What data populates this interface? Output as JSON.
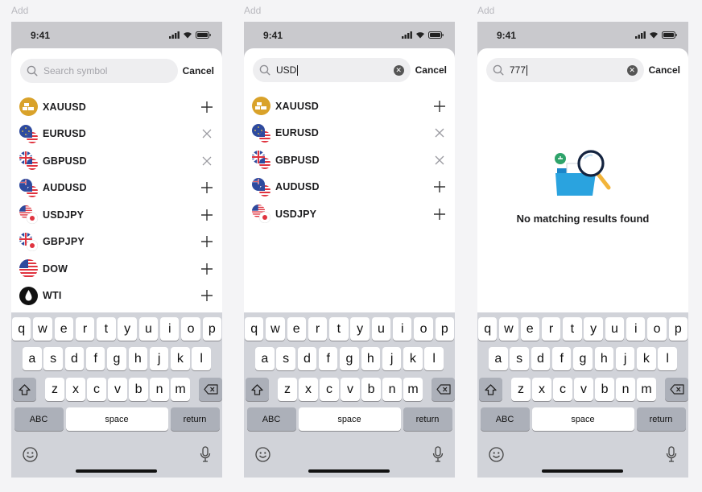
{
  "frames": [
    {
      "add_label": "Add",
      "time": "9:41",
      "search": {
        "value": "",
        "placeholder": "Search symbol",
        "cancel": "Cancel"
      },
      "rows": [
        {
          "symbol": "XAUUSD",
          "icon": "gold-icon",
          "action": "add"
        },
        {
          "symbol": "EURUSD",
          "icon": "eu-us-flag-icon",
          "action": "remove"
        },
        {
          "symbol": "GBPUSD",
          "icon": "uk-us-flag-icon",
          "action": "remove"
        },
        {
          "symbol": "AUDUSD",
          "icon": "au-us-flag-icon",
          "action": "add"
        },
        {
          "symbol": "USDJPY",
          "icon": "us-jp-flag-icon",
          "action": "add"
        },
        {
          "symbol": "GBPJPY",
          "icon": "uk-jp-flag-icon",
          "action": "add"
        },
        {
          "symbol": "DOW",
          "icon": "us-flag-icon",
          "action": "add"
        },
        {
          "symbol": "WTI",
          "icon": "oil-drop-icon",
          "action": "add"
        }
      ],
      "empty_message": ""
    },
    {
      "add_label": "Add",
      "time": "9:41",
      "search": {
        "value": "USD",
        "placeholder": "",
        "cancel": "Cancel"
      },
      "rows": [
        {
          "symbol": "XAUUSD",
          "icon": "gold-icon",
          "action": "add"
        },
        {
          "symbol": "EURUSD",
          "icon": "eu-us-flag-icon",
          "action": "remove"
        },
        {
          "symbol": "GBPUSD",
          "icon": "uk-us-flag-icon",
          "action": "remove"
        },
        {
          "symbol": "AUDUSD",
          "icon": "au-us-flag-icon",
          "action": "add"
        },
        {
          "symbol": "USDJPY",
          "icon": "us-jp-flag-icon",
          "action": "add"
        }
      ],
      "empty_message": ""
    },
    {
      "add_label": "Add",
      "time": "9:41",
      "search": {
        "value": "777",
        "placeholder": "",
        "cancel": "Cancel"
      },
      "rows": [],
      "empty_message": "No matching results found"
    }
  ],
  "keyboard": {
    "row1": [
      "q",
      "w",
      "e",
      "r",
      "t",
      "y",
      "u",
      "i",
      "o",
      "p"
    ],
    "row2": [
      "a",
      "s",
      "d",
      "f",
      "g",
      "h",
      "j",
      "k",
      "l"
    ],
    "row3": [
      "z",
      "x",
      "c",
      "v",
      "b",
      "n",
      "m"
    ],
    "abc": "ABC",
    "space": "space",
    "return": "return"
  },
  "colors": {
    "gold": "#d9a22a",
    "us_red": "#e0333f",
    "us_blue": "#2e4a9e",
    "folder_blue": "#2aa3df"
  }
}
